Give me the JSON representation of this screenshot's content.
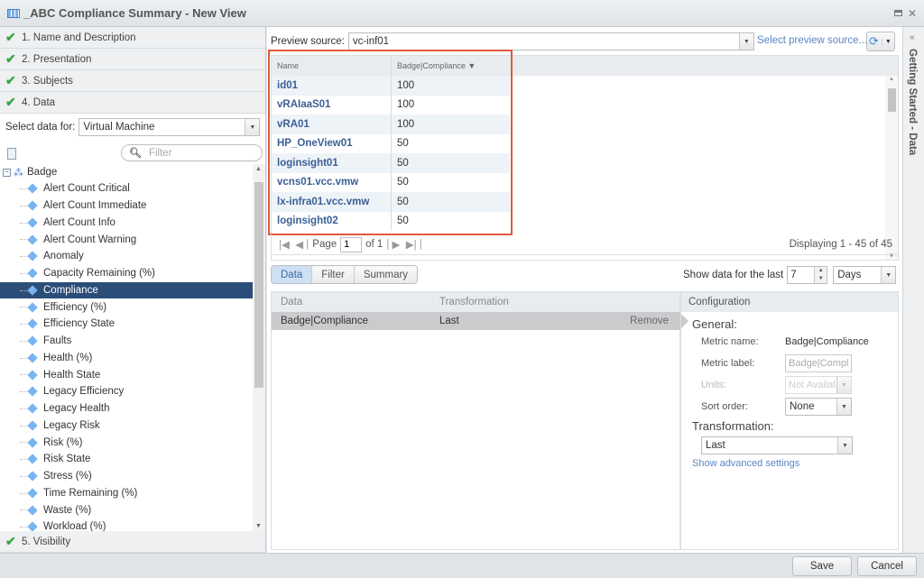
{
  "window": {
    "title": "_ABC Compliance Summary - New View",
    "icon": "table-icon",
    "restore_icon": "restore-icon",
    "close_icon": "close-icon"
  },
  "steps": [
    {
      "label": "1. Name and Description",
      "icon": "check-icon"
    },
    {
      "label": "2. Presentation",
      "icon": "check-icon"
    },
    {
      "label": "3. Subjects",
      "icon": "check-icon"
    },
    {
      "label": "4. Data",
      "icon": "check-icon"
    },
    {
      "label": "5. Visibility",
      "icon": "check-icon"
    }
  ],
  "left": {
    "select_label": "Select data for:",
    "select_value": "Virtual Machine",
    "filter_placeholder": "Filter",
    "tree_root": "Badge",
    "tree_items": [
      "Alert Count Critical",
      "Alert Count Immediate",
      "Alert Count Info",
      "Alert Count Warning",
      "Anomaly",
      "Capacity Remaining (%)",
      "Compliance",
      "Efficiency (%)",
      "Efficiency State",
      "Faults",
      "Health (%)",
      "Health State",
      "Legacy Efficiency",
      "Legacy Health",
      "Legacy Risk",
      "Risk (%)",
      "Risk State",
      "Stress (%)",
      "Time Remaining (%)",
      "Waste (%)",
      "Workload (%)"
    ],
    "selected_item": "Compliance"
  },
  "preview": {
    "label": "Preview source:",
    "value": "vc-inf01",
    "select_link": "Select preview source...",
    "columns": [
      "Name",
      "Badge|Compliance"
    ],
    "sort_indicator": "▼",
    "rows": [
      {
        "name": "id01",
        "value": "100"
      },
      {
        "name": "vRAIaaS01",
        "value": "100"
      },
      {
        "name": "vRA01",
        "value": "100"
      },
      {
        "name": "HP_OneView01",
        "value": "50"
      },
      {
        "name": "loginsight01",
        "value": "50"
      },
      {
        "name": "vcns01.vcc.vmw",
        "value": "50"
      },
      {
        "name": "lx-infra01.vcc.vmw",
        "value": "50"
      },
      {
        "name": "loginsight02",
        "value": "50"
      }
    ],
    "pager": {
      "page_label": "Page",
      "page": "1",
      "of_label": "of 1",
      "displaying": "Displaying 1 - 45 of 45"
    }
  },
  "tabs": [
    "Data",
    "Filter",
    "Summary"
  ],
  "active_tab": "Data",
  "show_data": {
    "label": "Show data for the last",
    "value": "7",
    "unit": "Days"
  },
  "data_table": {
    "columns": [
      "Data",
      "Transformation"
    ],
    "rows": [
      {
        "data": "Badge|Compliance",
        "transformation": "Last",
        "action": "Remove"
      }
    ]
  },
  "config": {
    "header": "Configuration",
    "general": "General:",
    "metric_name_label": "Metric name:",
    "metric_name": "Badge|Compliance",
    "metric_label_label": "Metric label:",
    "metric_label_placeholder": "Badge|Compl",
    "units_label": "Units:",
    "units_value": "Not Availal",
    "sort_label": "Sort order:",
    "sort_value": "None",
    "transformation_label": "Transformation:",
    "transformation_value": "Last",
    "advanced_link": "Show advanced settings"
  },
  "side_panel": {
    "label": "Getting Started - Data",
    "chevron": "«"
  },
  "footer": {
    "save": "Save",
    "cancel": "Cancel"
  }
}
